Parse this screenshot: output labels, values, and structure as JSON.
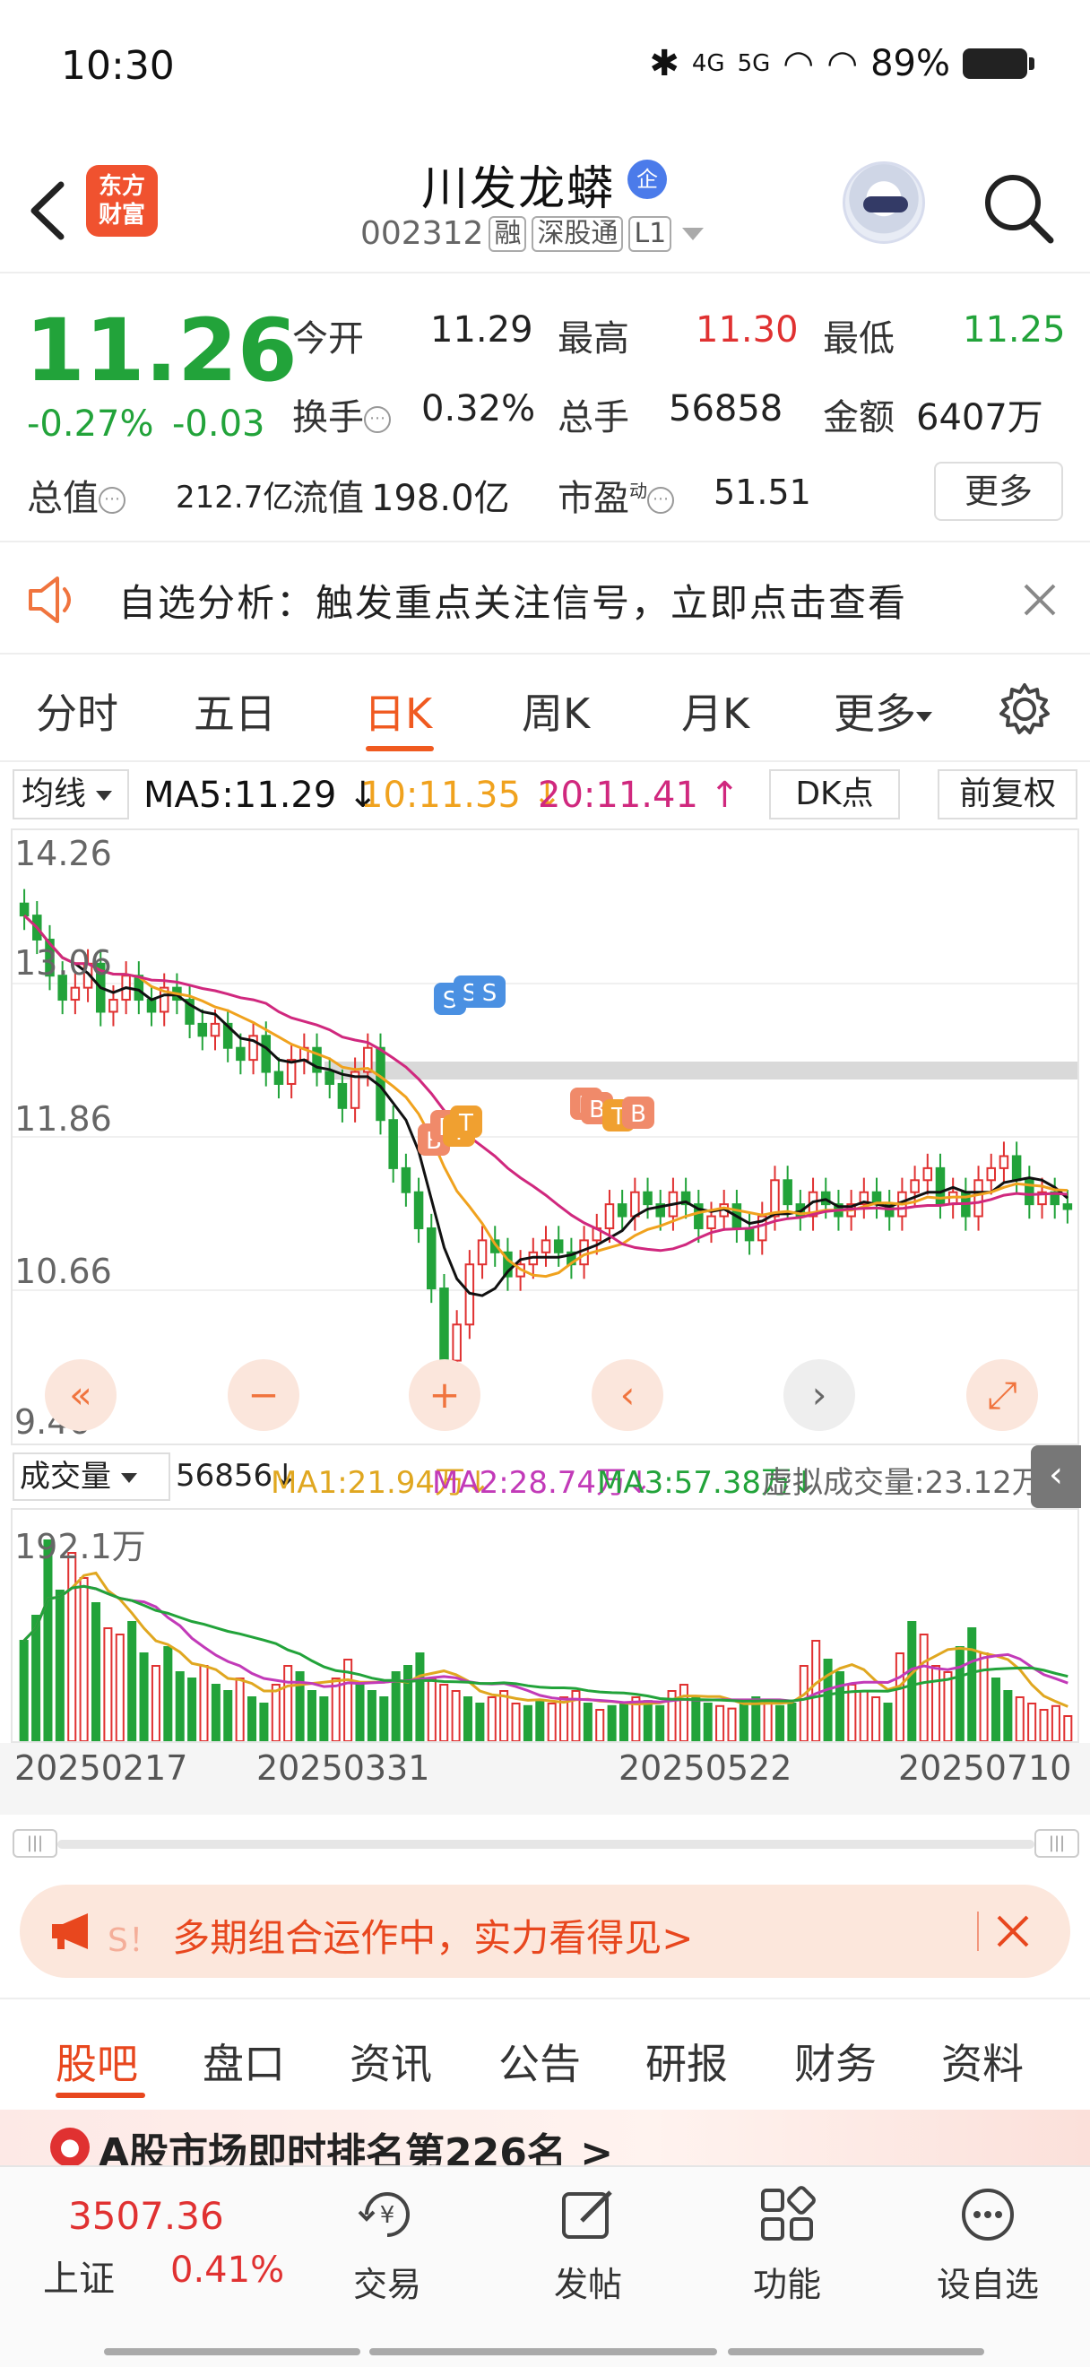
{
  "status": {
    "time": "10:30",
    "net1": "4G",
    "net2": "5G",
    "battery": "89%"
  },
  "header": {
    "logo_line1": "东方",
    "logo_line2": "财富",
    "stock_name": "川发龙蟒",
    "badge": "企",
    "stock_code": "002312",
    "tags": [
      "融",
      "深股通",
      "L1"
    ]
  },
  "quote": {
    "price": "11.26",
    "change_pct": "-0.27%",
    "change": "-0.03",
    "open_label": "今开",
    "open": "11.29",
    "high_label": "最高",
    "high": "11.30",
    "low_label": "最低",
    "low": "11.25",
    "turnover_label": "换手",
    "turnover": "0.32%",
    "volume_label": "总手",
    "volume": "56858",
    "amount_label": "金额",
    "amount": "6407万",
    "mktcap_label": "总值",
    "mktcap": "212.7亿",
    "float_label": "流值",
    "float_cap": "198.0亿",
    "pe_label": "市盈",
    "pe_sup": "动",
    "pe": "51.51",
    "more_label": "更多"
  },
  "alert": {
    "text": "自选分析：触发重点关注信号，立即点击查看"
  },
  "chart_tabs": [
    "分时",
    "五日",
    "日K",
    "周K",
    "月K",
    "更多"
  ],
  "ma_row": {
    "select": "均线",
    "ma5": "MA5:11.29 ↓",
    "ma10": "10:11.35 ↓",
    "ma20": "20:11.41 ↑",
    "dk": "DK点",
    "adjust": "前复权"
  },
  "colors": {
    "up": "#e03131",
    "down": "#22a33a",
    "ma5": "#111111",
    "ma10": "#f0a21e",
    "ma20": "#d0287e",
    "accent": "#f05a20"
  },
  "chart_data": [
    {
      "type": "candlestick",
      "y_ticks": [
        "14.26",
        "13.06",
        "11.86",
        "10.66",
        "9.46"
      ],
      "ylim": [
        9.46,
        14.26
      ],
      "markers": [
        "B",
        "B",
        "T",
        "T",
        "S",
        "S",
        "S",
        "B",
        "B",
        "T",
        "B"
      ],
      "close": [
        13.7,
        13.5,
        13.2,
        13.0,
        13.1,
        13.3,
        12.9,
        13.0,
        13.2,
        13.0,
        12.9,
        13.1,
        13.0,
        12.8,
        12.7,
        12.8,
        12.6,
        12.5,
        12.7,
        12.4,
        12.3,
        12.5,
        12.6,
        12.4,
        12.3,
        12.1,
        12.4,
        12.6,
        12.0,
        11.6,
        11.4,
        11.1,
        10.6,
        10.0,
        10.3,
        10.8,
        11.0,
        10.9,
        10.7,
        10.8,
        10.9,
        11.0,
        10.9,
        10.8,
        11.0,
        11.1,
        11.3,
        11.2,
        11.4,
        11.3,
        11.2,
        11.4,
        11.3,
        11.1,
        11.2,
        11.3,
        11.1,
        11.0,
        11.2,
        11.5,
        11.3,
        11.2,
        11.4,
        11.3,
        11.2,
        11.3,
        11.4,
        11.3,
        11.2,
        11.4,
        11.5,
        11.6,
        11.3,
        11.4,
        11.2,
        11.5,
        11.6,
        11.7,
        11.5,
        11.3,
        11.4,
        11.3,
        11.26
      ]
    },
    {
      "type": "bar",
      "title": "成交量",
      "max_label": "192.1万",
      "vol": "56856↓",
      "ma1": "MA1:21.94万↓",
      "ma2": "MA2:28.74万↓",
      "ma3": "MA3:57.38万↓",
      "virtual": "虚拟成交量:23.12万",
      "x_ticks": [
        "20250217",
        "20250331",
        "20250522",
        "20250710"
      ],
      "values": [
        80,
        100,
        160,
        120,
        150,
        130,
        110,
        90,
        85,
        95,
        70,
        60,
        75,
        55,
        50,
        60,
        45,
        40,
        50,
        35,
        30,
        45,
        60,
        55,
        40,
        35,
        50,
        65,
        45,
        40,
        35,
        55,
        60,
        70,
        50,
        45,
        40,
        35,
        30,
        35,
        40,
        30,
        28,
        32,
        30,
        35,
        40,
        30,
        25,
        28,
        30,
        35,
        32,
        28,
        40,
        45,
        35,
        30,
        28,
        26,
        30,
        35,
        32,
        28,
        30,
        60,
        80,
        65,
        55,
        45,
        40,
        35,
        30,
        70,
        95,
        85,
        60,
        55,
        75,
        90,
        70,
        50,
        40,
        35,
        30,
        25,
        28,
        20
      ]
    }
  ],
  "promo": {
    "text": "多期组合运作中，实力看得见>",
    "fade": "S！"
  },
  "bottom_tabs": [
    "股吧",
    "盘口",
    "资讯",
    "公告",
    "研报",
    "财务",
    "资料"
  ],
  "news": {
    "text": "A股市场即时排名第226名 >"
  },
  "footer": {
    "index_value": "3507.36",
    "index_name": "上证",
    "index_pct": "0.41%",
    "nav": [
      {
        "label": "交易",
        "icon": "trade-icon"
      },
      {
        "label": "发帖",
        "icon": "post-icon"
      },
      {
        "label": "功能",
        "icon": "grid-icon"
      },
      {
        "label": "设自选",
        "icon": "more-dots-icon"
      }
    ]
  }
}
